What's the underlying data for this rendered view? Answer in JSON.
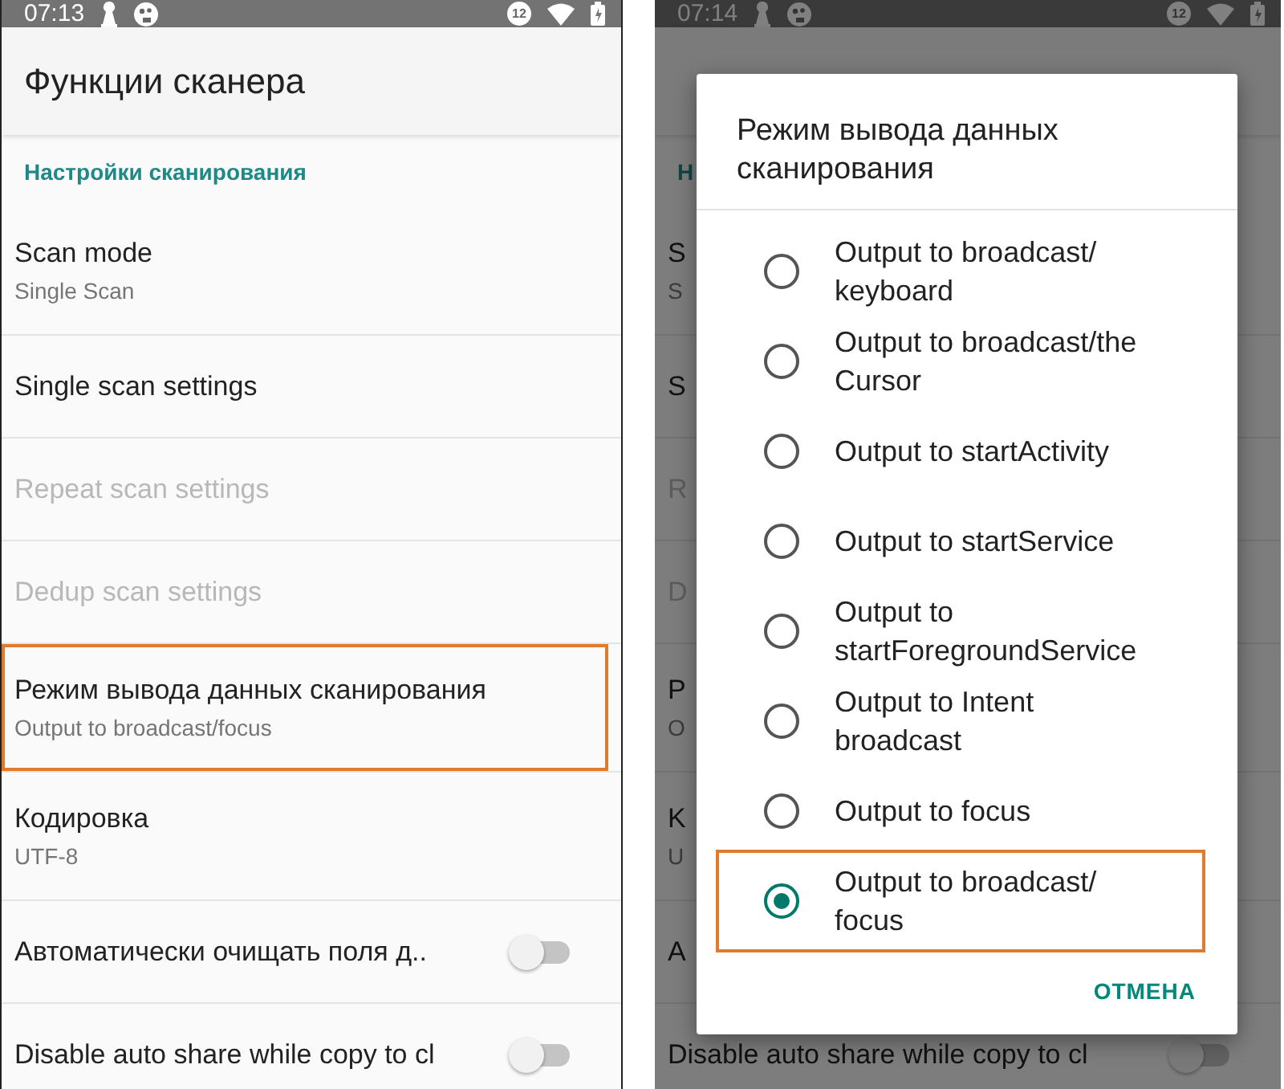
{
  "screens": [
    {
      "dimmed": false,
      "status_bar": {
        "time": "07:13",
        "notification_count": "12"
      },
      "title": "Функции сканера",
      "category": "Настройки сканирования",
      "items": [
        {
          "kind": "pref",
          "title": "Scan mode",
          "summary": "Single Scan",
          "disabled": false,
          "highlighted": false
        },
        {
          "kind": "pref",
          "title": "Single scan settings",
          "disabled": false,
          "highlighted": false
        },
        {
          "kind": "pref",
          "title": "Repeat scan settings",
          "disabled": true,
          "highlighted": false
        },
        {
          "kind": "pref",
          "title": "Dedup scan settings",
          "disabled": true,
          "highlighted": false
        },
        {
          "kind": "pref",
          "title": "Режим вывода данных сканирования",
          "summary": "Output to broadcast/focus",
          "disabled": false,
          "highlighted": true
        },
        {
          "kind": "pref",
          "title": "Кодировка",
          "summary": "UTF-8",
          "disabled": false,
          "highlighted": false
        },
        {
          "kind": "switch",
          "title": "Автоматически очищать поля д..",
          "on": false,
          "disabled": false,
          "highlighted": false
        },
        {
          "kind": "switch",
          "title": "Disable auto share while copy to cl",
          "on": false,
          "disabled": false,
          "highlighted": false
        }
      ]
    },
    {
      "dimmed": true,
      "status_bar": {
        "time": "07:14",
        "notification_count": "12"
      },
      "category": "Н",
      "items": [
        {
          "kind": "pref",
          "title": "S",
          "summary": "S",
          "disabled": false,
          "highlighted": false
        },
        {
          "kind": "pref",
          "title": "S",
          "disabled": false,
          "highlighted": false
        },
        {
          "kind": "pref",
          "title": "R",
          "disabled": true,
          "highlighted": false
        },
        {
          "kind": "pref",
          "title": "D",
          "disabled": true,
          "highlighted": false
        },
        {
          "kind": "pref",
          "title": "P",
          "summary": "O",
          "disabled": false,
          "highlighted": false
        },
        {
          "kind": "pref",
          "title": "K",
          "summary": "U",
          "disabled": false,
          "highlighted": false
        },
        {
          "kind": "pref",
          "title": "A",
          "disabled": false,
          "highlighted": false
        },
        {
          "kind": "switch",
          "title": "Disable auto share while copy to cl",
          "on": false,
          "disabled": false,
          "highlighted": false
        }
      ],
      "dialog": {
        "title": "Режим вывода данных сканирования",
        "options": [
          {
            "label": "Output to broadcast/ keyboard",
            "selected": false,
            "highlighted": false
          },
          {
            "label": "Output to broadcast/the Cursor",
            "selected": false,
            "highlighted": false
          },
          {
            "label": "Output to startActivity",
            "selected": false,
            "highlighted": false
          },
          {
            "label": "Output to startService",
            "selected": false,
            "highlighted": false
          },
          {
            "label": "Output to startForegroundService",
            "selected": false,
            "highlighted": false
          },
          {
            "label": "Output to Intent broadcast",
            "selected": false,
            "highlighted": false
          },
          {
            "label": "Output to focus",
            "selected": false,
            "highlighted": false
          },
          {
            "label": "Output to broadcast/ focus",
            "selected": true,
            "highlighted": true
          }
        ],
        "cancel": "ОТМЕНА"
      }
    }
  ]
}
